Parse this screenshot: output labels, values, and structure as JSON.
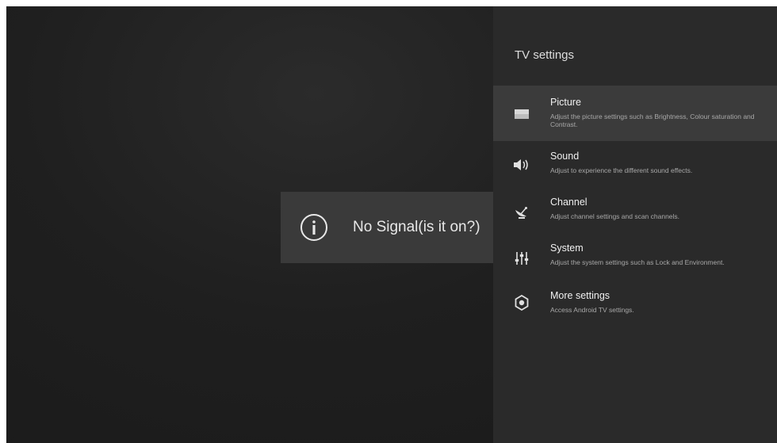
{
  "toast": {
    "icon": "info-circle-icon",
    "message": "No Signal(is it on?)"
  },
  "settings_panel": {
    "title": "TV settings",
    "items": [
      {
        "title": "Picture",
        "description": "Adjust the picture settings such as Brightness, Colour saturation and Contrast.",
        "icon": "picture-icon",
        "selected": true
      },
      {
        "title": "Sound",
        "description": "Adjust to experience the different sound effects.",
        "icon": "speaker-icon",
        "selected": false
      },
      {
        "title": "Channel",
        "description": "Adjust channel settings and scan channels.",
        "icon": "satellite-dish-icon",
        "selected": false
      },
      {
        "title": "System",
        "description": "Adjust the system settings such as Lock and Environment.",
        "icon": "sliders-icon",
        "selected": false
      },
      {
        "title": "More settings",
        "description": "Access Android TV settings.",
        "icon": "gear-icon",
        "selected": false
      }
    ]
  },
  "colors": {
    "background": "#1f1f1f",
    "panel": "#2a2a2a",
    "selected_item": "#3b3b3b",
    "toast": "#3a3a3a",
    "text_primary": "#f0f0f0",
    "text_secondary": "#a8a8a8"
  }
}
